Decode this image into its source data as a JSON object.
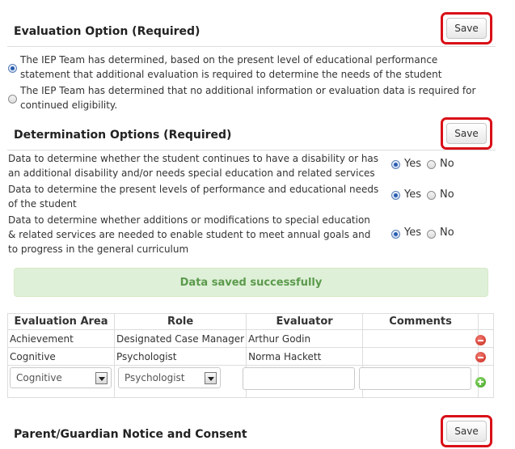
{
  "evaluation_option": {
    "title": "Evaluation Option (Required)",
    "save_label": "Save",
    "options": [
      {
        "label": "The IEP Team has determined, based on the present level of educational performance statement that additional evaluation is required to determine the needs of the student",
        "selected": true
      },
      {
        "label": "The IEP Team has determined that no additional information or evaluation data is required for continued eligibility.",
        "selected": false
      }
    ]
  },
  "determination_options": {
    "title": "Determination Options (Required)",
    "save_label": "Save",
    "yes_label": "Yes",
    "no_label": "No",
    "rows": [
      {
        "question": "Data to determine whether the student continues to have a disability or has an additional disability and/or needs special education and related services",
        "answer": "Yes"
      },
      {
        "question": "Data to determine the present levels of performance and educational needs of the student",
        "answer": "Yes"
      },
      {
        "question": "Data to determine whether additions or modifications to special education & related services are needed to enable student to meet annual goals and to progress in the general curriculum",
        "answer": "Yes"
      }
    ]
  },
  "status_message": "Data saved successfully",
  "evaluators_table": {
    "headers": [
      "Evaluation Area",
      "Role",
      "Evaluator",
      "Comments"
    ],
    "rows": [
      {
        "area": "Achievement",
        "role": "Designated Case Manager",
        "evaluator": "Arthur Godin",
        "comments": ""
      },
      {
        "area": "Cognitive",
        "role": "Psychologist",
        "evaluator": "Norma Hackett",
        "comments": ""
      }
    ],
    "new_row": {
      "area_select": "Cognitive",
      "role_select": "Psychologist",
      "evaluator_value": "",
      "comments_value": ""
    }
  },
  "parent_notice": {
    "title": "Parent/Guardian Notice and Consent",
    "save_label": "Save"
  },
  "colors": {
    "save_highlight": "#d90f17",
    "success_bg": "#dff0d8",
    "success_text": "#5b9a4c",
    "radio_selected": "#2a5db0"
  }
}
